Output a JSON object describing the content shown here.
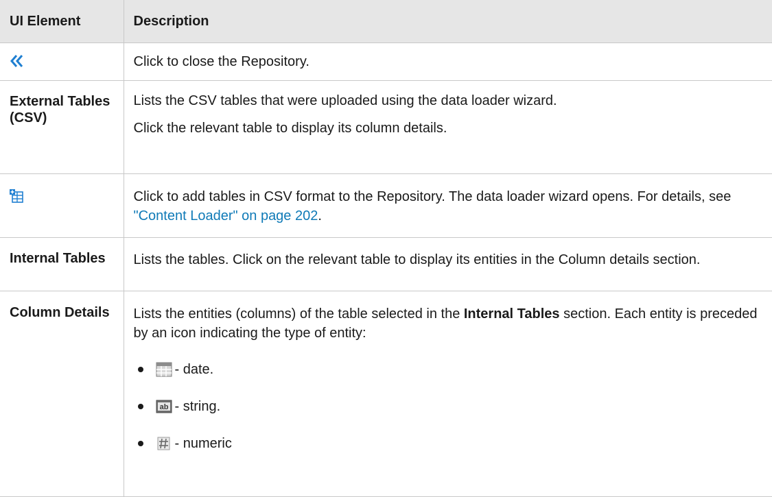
{
  "header": {
    "col1": "UI Element",
    "col2": "Description"
  },
  "rows": {
    "close": {
      "icon": "double-chevron-left-icon",
      "desc": "Click to close the Repository."
    },
    "external": {
      "element": "External Tables (CSV)",
      "desc1": "Lists the CSV tables that were uploaded using the data loader wizard.",
      "desc2": "Click the relevant table to display its column details."
    },
    "add": {
      "icon": "add-table-icon",
      "desc_before": "Click to add tables in CSV format to the Repository. The data loader wizard opens. For details, see ",
      "link": "\"Content Loader\" on page 202",
      "desc_after": "."
    },
    "internal": {
      "element": "Internal Tables",
      "desc": "Lists the tables. Click on the relevant table to display its entities in the Column details section."
    },
    "column": {
      "element": "Column Details",
      "desc_before": "Lists the entities (columns) of the table selected in the ",
      "desc_bold": "Internal Tables",
      "desc_after": " section. Each entity is preceded by an icon indicating the type of entity:",
      "types": [
        {
          "icon": "date-type-icon",
          "label": " - date."
        },
        {
          "icon": "string-type-icon",
          "label": " - string."
        },
        {
          "icon": "numeric-type-icon",
          "label": " - numeric"
        }
      ]
    }
  },
  "colors": {
    "header_bg": "#e6e6e6",
    "link": "#0f7ab7",
    "border": "#c8c8c8",
    "icon_blue": "#1f7fd1"
  }
}
